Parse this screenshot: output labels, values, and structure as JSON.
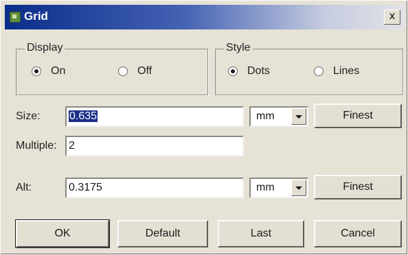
{
  "window": {
    "title": "Grid",
    "close_label": "x"
  },
  "display": {
    "title": "Display",
    "options": [
      {
        "label": "On",
        "checked": true
      },
      {
        "label": "Off",
        "checked": false
      }
    ]
  },
  "style": {
    "title": "Style",
    "options": [
      {
        "label": "Dots",
        "checked": true
      },
      {
        "label": "Lines",
        "checked": false
      }
    ]
  },
  "size": {
    "label": "Size:",
    "value": "0.635",
    "unit": "mm",
    "button": "Finest"
  },
  "multiple": {
    "label": "Multiple:",
    "value": "2"
  },
  "alt": {
    "label": "Alt:",
    "value": "0.3175",
    "unit": "mm",
    "button": "Finest"
  },
  "buttons": {
    "ok": "OK",
    "default": "Default",
    "last": "Last",
    "cancel": "Cancel"
  }
}
